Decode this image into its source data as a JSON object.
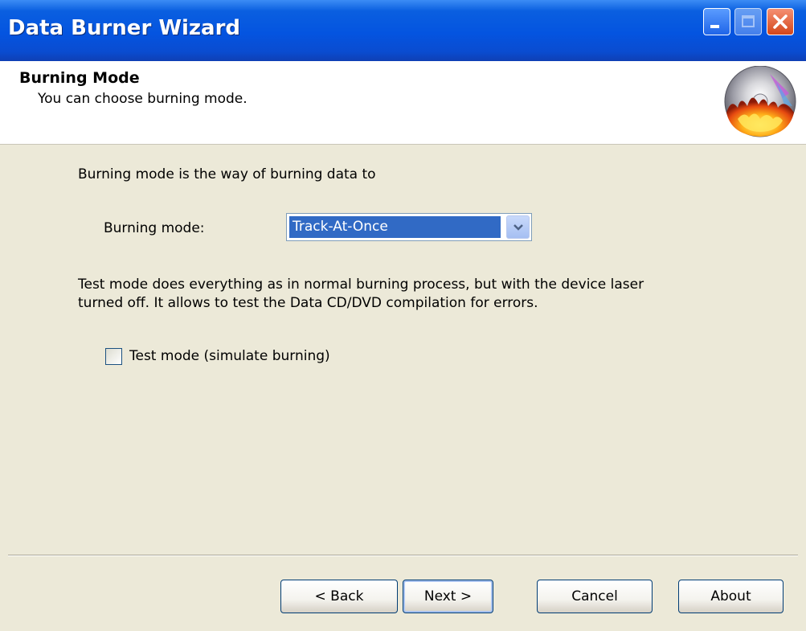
{
  "window": {
    "title": "Data Burner Wizard"
  },
  "header": {
    "title": "Burning Mode",
    "subtitle": "You can choose burning mode."
  },
  "content": {
    "intro_text": "Burning mode is the way of burning data to",
    "burning_mode_label": "Burning mode:",
    "burning_mode_value": "Track-At-Once",
    "test_mode_description_line1": "Test mode does everything as in normal burning process, but with the device laser",
    "test_mode_description_line2": "turned off. It allows to test the Data CD/DVD compilation for errors.",
    "test_mode_checkbox_label": "Test mode (simulate burning)",
    "test_mode_checked": false
  },
  "buttons": {
    "back": "< Back",
    "next": "Next >",
    "cancel": "Cancel",
    "about": "About"
  },
  "icons": {
    "minimize": "minimize-icon",
    "maximize": "maximize-icon",
    "close": "close-icon",
    "logo": "burning-disc-icon",
    "dropdown": "chevron-down-icon"
  },
  "colors": {
    "titlebar": "#0454e0",
    "dialog_background": "#ece9d8",
    "selection": "#316ac5",
    "close_button": "#d3461a"
  }
}
